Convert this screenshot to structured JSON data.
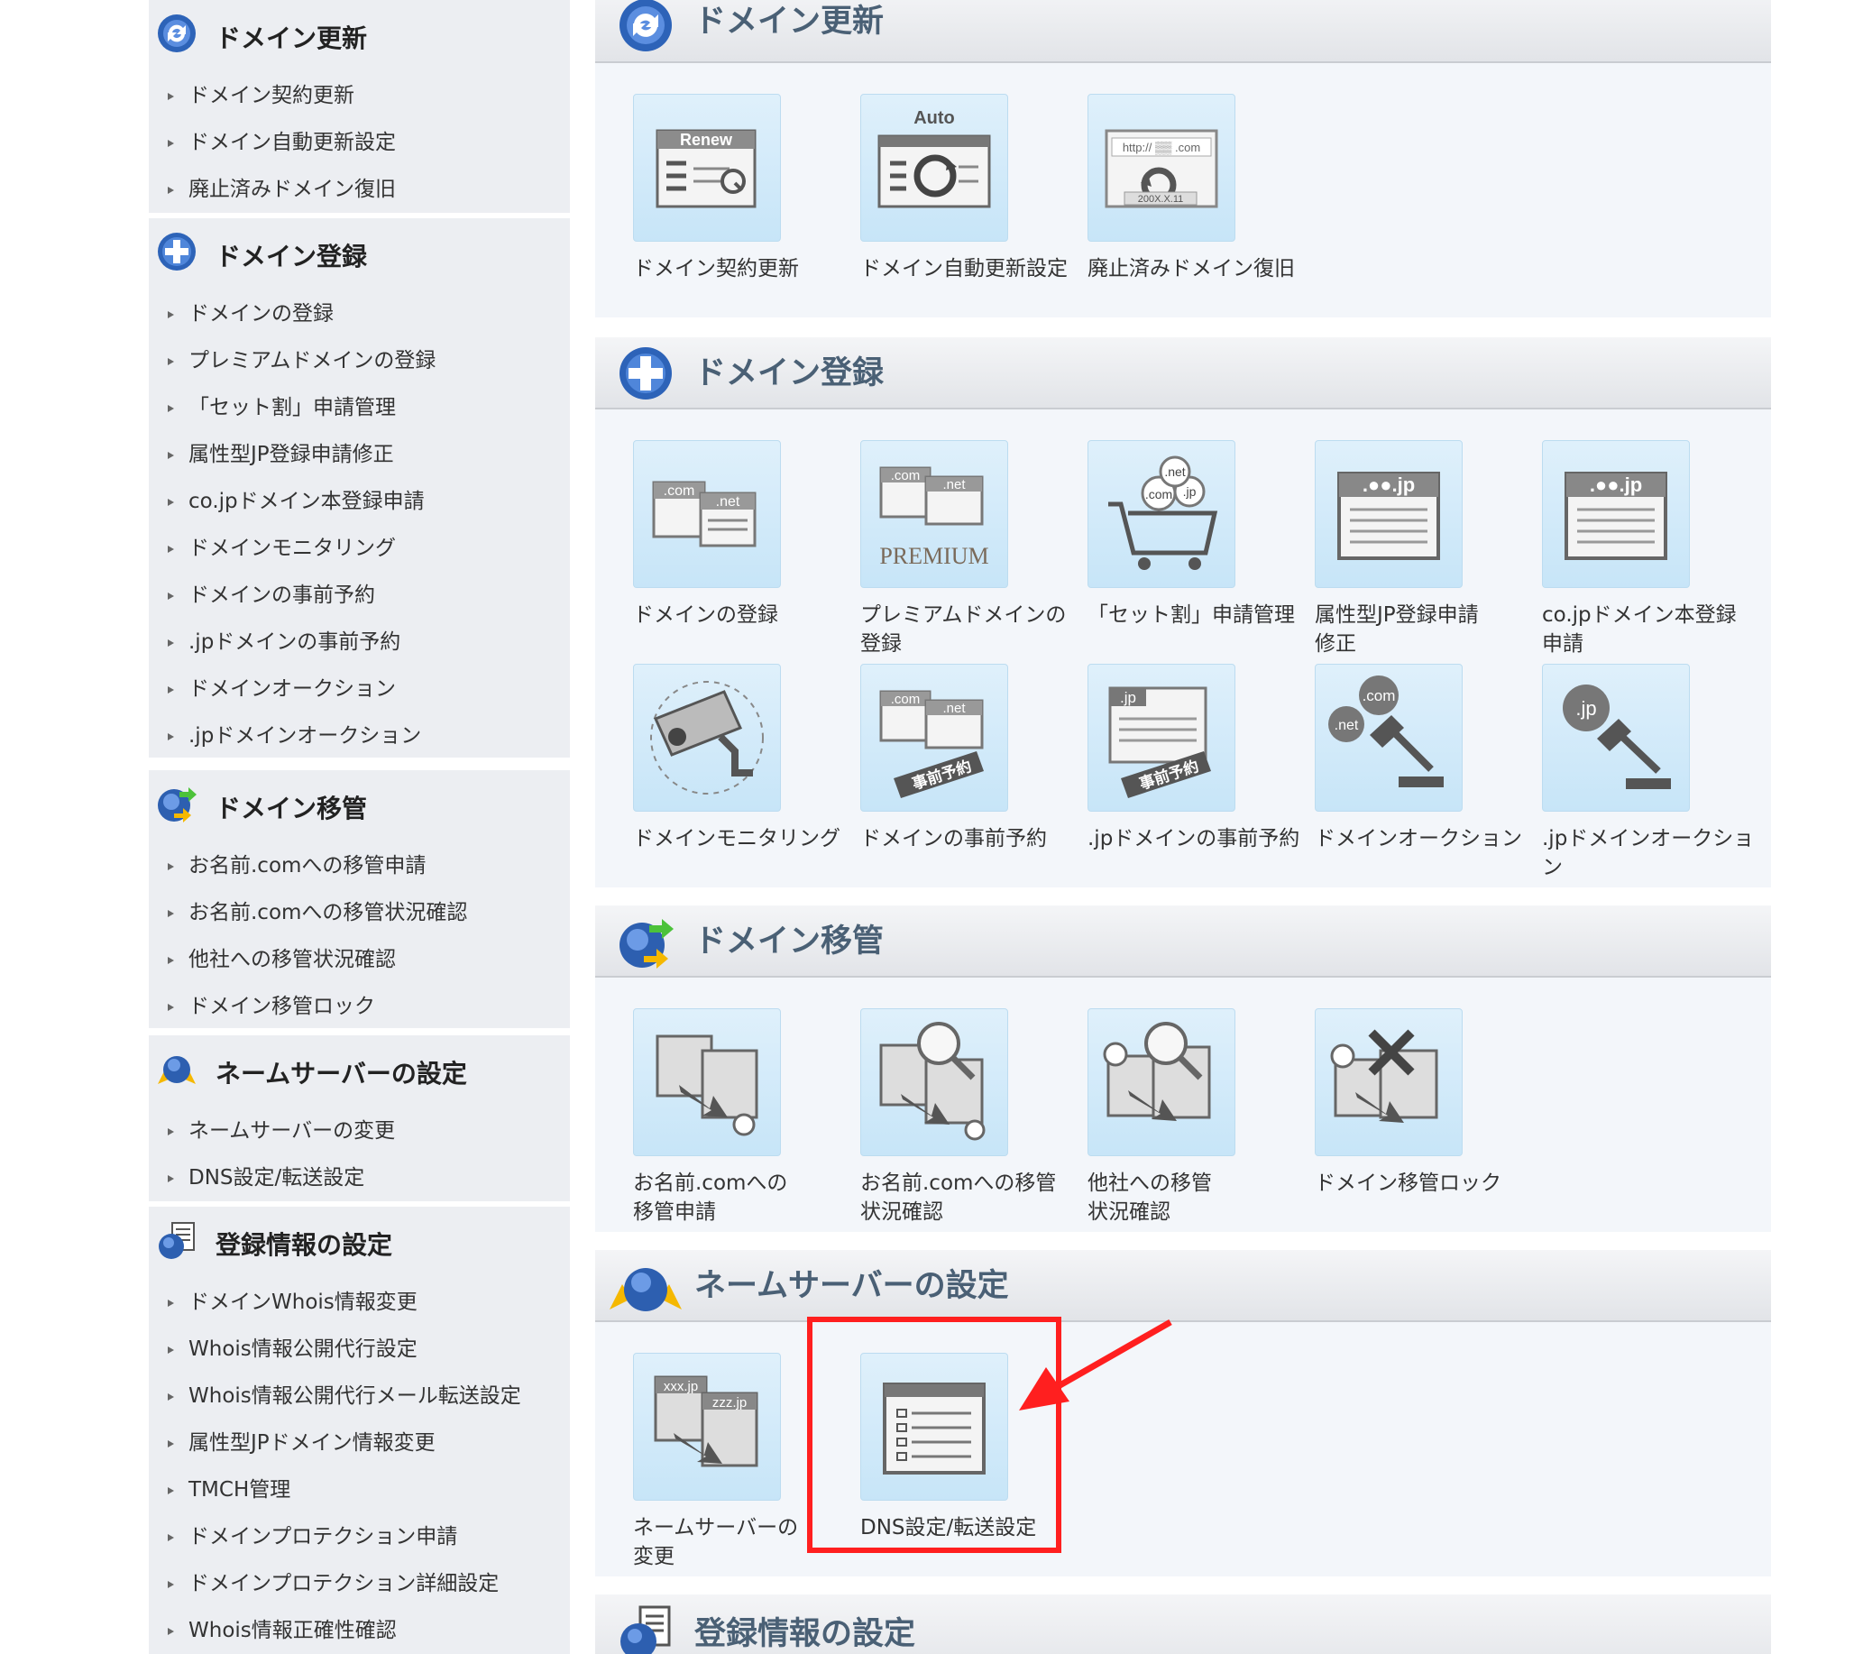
{
  "sidebar": {
    "renewal": {
      "title": "ドメイン更新",
      "items": [
        "ドメイン契約更新",
        "ドメイン自動更新設定",
        "廃止済みドメイン復旧"
      ]
    },
    "registration": {
      "title": "ドメイン登録",
      "items": [
        "ドメインの登録",
        "プレミアムドメインの登録",
        "「セット割」申請管理",
        "属性型JP登録申請修正",
        "co.jpドメイン本登録申請",
        "ドメインモニタリング",
        "ドメインの事前予約",
        ".jpドメインの事前予約",
        "ドメインオークション",
        ".jpドメインオークション"
      ]
    },
    "transfer": {
      "title": "ドメイン移管",
      "items": [
        "お名前.comへの移管申請",
        "お名前.comへの移管状況確認",
        "他社への移管状況確認",
        "ドメイン移管ロック"
      ]
    },
    "nameserver": {
      "title": "ネームサーバーの設定",
      "items": [
        "ネームサーバーの変更",
        "DNS設定/転送設定"
      ]
    },
    "registrant": {
      "title": "登録情報の設定",
      "items": [
        "ドメインWhois情報変更",
        "Whois情報公開代行設定",
        "Whois情報公開代行メール転送設定",
        "属性型JPドメイン情報変更",
        "TMCH管理",
        "ドメインプロテクション申請",
        "ドメインプロテクション詳細設定",
        "Whois情報正確性確認"
      ]
    }
  },
  "main": {
    "renewal": {
      "title": "ドメイン更新",
      "tiles": [
        {
          "icon": "renew-icon",
          "img_text": "Renew",
          "label": [
            "ドメイン契約更新"
          ]
        },
        {
          "icon": "auto-renew-icon",
          "img_text": "Auto",
          "label": [
            "ドメイン自動更新設定"
          ]
        },
        {
          "icon": "restore-domain-icon",
          "img_text": "http:// ▒▒ .com",
          "img_sub": "200X.X.11",
          "label": [
            "廃止済みドメイン復旧"
          ]
        }
      ]
    },
    "registration": {
      "title": "ドメイン登録",
      "tiles": [
        {
          "icon": "domain-register-icon",
          "img_text": ".com",
          "img_sub": ".net",
          "label": [
            "ドメインの登録"
          ]
        },
        {
          "icon": "premium-domain-icon",
          "img_text": ".com",
          "img_sub": ".net",
          "img_extra": "PREMIUM",
          "label": [
            "プレミアムドメインの",
            "登録"
          ]
        },
        {
          "icon": "set-discount-cart-icon",
          "img_text": ".com",
          "img_sub": ".net",
          "img_extra": ".jp",
          "label": [
            "「セット割」申請管理"
          ]
        },
        {
          "icon": "jp-attribute-icon",
          "img_text": ".●●.jp",
          "label": [
            "属性型JP登録申請",
            "修正"
          ]
        },
        {
          "icon": "cojp-register-icon",
          "img_text": ".●●.jp",
          "label": [
            "co.jpドメイン本登録",
            "申請"
          ]
        },
        {
          "icon": "monitoring-camera-icon",
          "label": [
            "ドメインモニタリング"
          ]
        },
        {
          "icon": "pre-reservation-icon",
          "img_text": ".com",
          "img_sub": ".net",
          "img_extra": "事前予約",
          "label": [
            "ドメインの事前予約"
          ]
        },
        {
          "icon": "jp-pre-reservation-icon",
          "img_text": ".jp",
          "img_extra": "事前予約",
          "label": [
            ".jpドメインの事前予約"
          ]
        },
        {
          "icon": "auction-gavel-icon",
          "img_text": ".com",
          "img_sub": ".net",
          "label": [
            "ドメインオークション"
          ]
        },
        {
          "icon": "jp-auction-gavel-icon",
          "img_text": ".jp",
          "label": [
            ".jpドメインオークショ",
            "ン"
          ]
        }
      ]
    },
    "transfer": {
      "title": "ドメイン移管",
      "tiles": [
        {
          "icon": "transfer-request-icon",
          "label": [
            "お名前.comへの",
            "移管申請"
          ]
        },
        {
          "icon": "transfer-status-icon",
          "label": [
            "お名前.comへの移管",
            "状況確認"
          ]
        },
        {
          "icon": "outbound-transfer-status-icon",
          "label": [
            "他社への移管",
            "状況確認"
          ]
        },
        {
          "icon": "transfer-lock-icon",
          "label": [
            "ドメイン移管ロック"
          ]
        }
      ]
    },
    "nameserver": {
      "title": "ネームサーバーの設定",
      "tiles": [
        {
          "icon": "nameserver-change-icon",
          "img_text": "xxx.jp",
          "img_sub": "zzz.jp",
          "label": [
            "ネームサーバーの",
            "変更"
          ]
        },
        {
          "icon": "dns-settings-icon",
          "label": [
            "DNS設定/転送設定"
          ]
        }
      ]
    },
    "registrant": {
      "title": "登録情報の設定"
    }
  },
  "colors": {
    "highlight": "#ff1f1f",
    "panel_title": "#4a6075",
    "tile_bg": "#d4ebf9"
  }
}
